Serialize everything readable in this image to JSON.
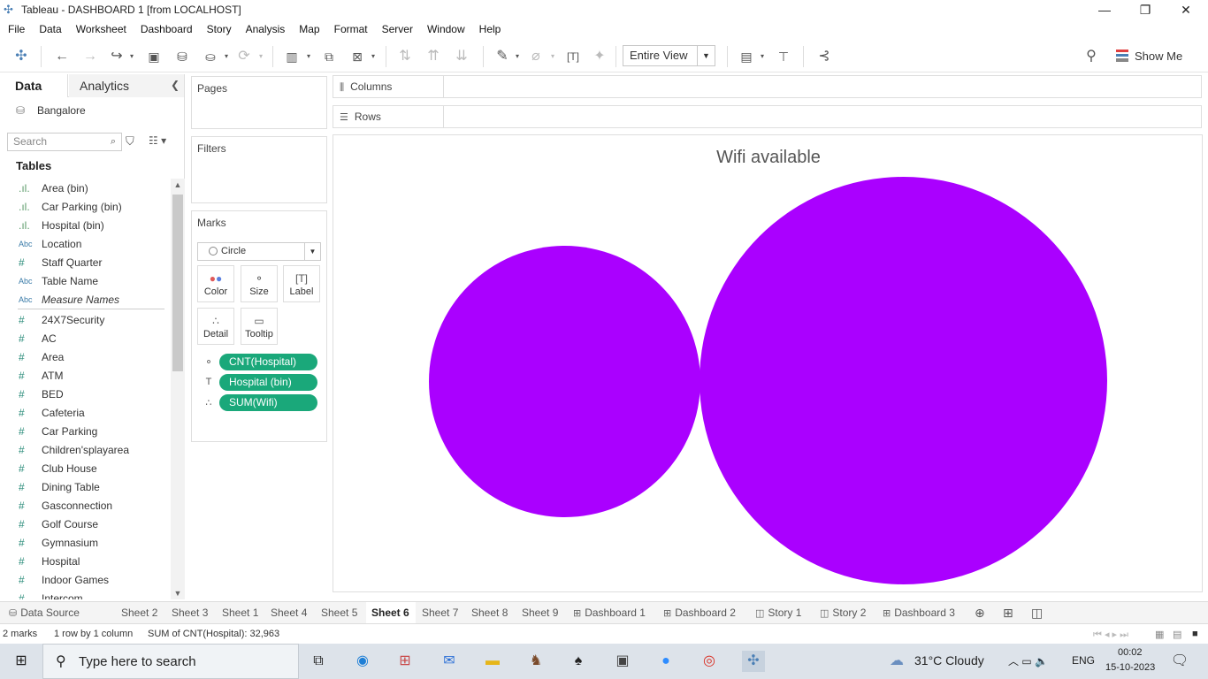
{
  "window": {
    "title": "Tableau - DASHBOARD 1 [from LOCALHOST]",
    "minimize": "—",
    "maximize": "❐",
    "close": "✕"
  },
  "menu": [
    "File",
    "Data",
    "Worksheet",
    "Dashboard",
    "Story",
    "Analysis",
    "Map",
    "Format",
    "Server",
    "Window",
    "Help"
  ],
  "toolbar": {
    "fit": "Entire View",
    "show_me": "Show Me"
  },
  "data_pane": {
    "tab_data": "Data",
    "tab_analytics": "Analytics",
    "datasource": "Bangalore",
    "search_placeholder": "Search",
    "tables_heading": "Tables",
    "fields": [
      {
        "type": "bin",
        "name": "Area (bin)"
      },
      {
        "type": "bin",
        "name": "Car Parking (bin)"
      },
      {
        "type": "bin",
        "name": "Hospital (bin)"
      },
      {
        "type": "abc",
        "name": "Location"
      },
      {
        "type": "measure",
        "name": "Staff Quarter"
      },
      {
        "type": "abc",
        "name": "Table Name"
      },
      {
        "type": "abc",
        "name": "Measure Names"
      },
      {
        "type": "measure",
        "name": "24X7Security"
      },
      {
        "type": "measure",
        "name": "AC"
      },
      {
        "type": "measure",
        "name": "Area"
      },
      {
        "type": "measure",
        "name": "ATM"
      },
      {
        "type": "measure",
        "name": "BED"
      },
      {
        "type": "measure",
        "name": "Cafeteria"
      },
      {
        "type": "measure",
        "name": "Car Parking"
      },
      {
        "type": "measure",
        "name": "Children'splayarea"
      },
      {
        "type": "measure",
        "name": "Club House"
      },
      {
        "type": "measure",
        "name": "Dining Table"
      },
      {
        "type": "measure",
        "name": "Gasconnection"
      },
      {
        "type": "measure",
        "name": "Golf Course"
      },
      {
        "type": "measure",
        "name": "Gymnasium"
      },
      {
        "type": "measure",
        "name": "Hospital"
      },
      {
        "type": "measure",
        "name": "Indoor Games"
      },
      {
        "type": "measure",
        "name": "Intercom"
      }
    ],
    "type_glyphs": {
      "bin": ".ıl.",
      "abc": "Abc",
      "measure": "#"
    }
  },
  "cards": {
    "pages": "Pages",
    "filters": "Filters",
    "marks": "Marks",
    "mark_type": "Circle",
    "buttons": [
      "Color",
      "Size",
      "Label",
      "Detail",
      "Tooltip"
    ],
    "pills": [
      {
        "icon": "size-icon",
        "label": "CNT(Hospital)"
      },
      {
        "icon": "label-icon",
        "label": "Hospital (bin)"
      },
      {
        "icon": "detail-icon",
        "label": "SUM(Wifi)"
      }
    ]
  },
  "shelves": {
    "columns": "Columns",
    "rows": "Rows"
  },
  "viz": {
    "title": "Wifi available",
    "bubble_color": "#aa00ff"
  },
  "sheet_tabs": [
    {
      "label": "Data Source",
      "kind": "datasource"
    },
    {
      "label": "Sheet 2",
      "kind": "sheet"
    },
    {
      "label": "Sheet 3",
      "kind": "sheet"
    },
    {
      "label": "Sheet 1",
      "kind": "sheet"
    },
    {
      "label": "Sheet 4",
      "kind": "sheet"
    },
    {
      "label": "Sheet 5",
      "kind": "sheet"
    },
    {
      "label": "Sheet 6",
      "kind": "sheet",
      "active": true
    },
    {
      "label": "Sheet 7",
      "kind": "sheet"
    },
    {
      "label": "Sheet 8",
      "kind": "sheet"
    },
    {
      "label": "Sheet 9",
      "kind": "sheet"
    },
    {
      "label": "Dashboard 1",
      "kind": "dashboard"
    },
    {
      "label": "Dashboard 2",
      "kind": "dashboard"
    },
    {
      "label": "Story 1",
      "kind": "story"
    },
    {
      "label": "Story 2",
      "kind": "story"
    },
    {
      "label": "Dashboard 3",
      "kind": "dashboard"
    }
  ],
  "status": {
    "marks": "2 marks",
    "dims": "1 row by 1 column",
    "sum": "SUM of CNT(Hospital): 32,963"
  },
  "taskbar": {
    "search_placeholder": "Type here to search",
    "weather": "31°C  Cloudy",
    "lang": "ENG",
    "time": "00:02",
    "date": "15-10-2023"
  }
}
